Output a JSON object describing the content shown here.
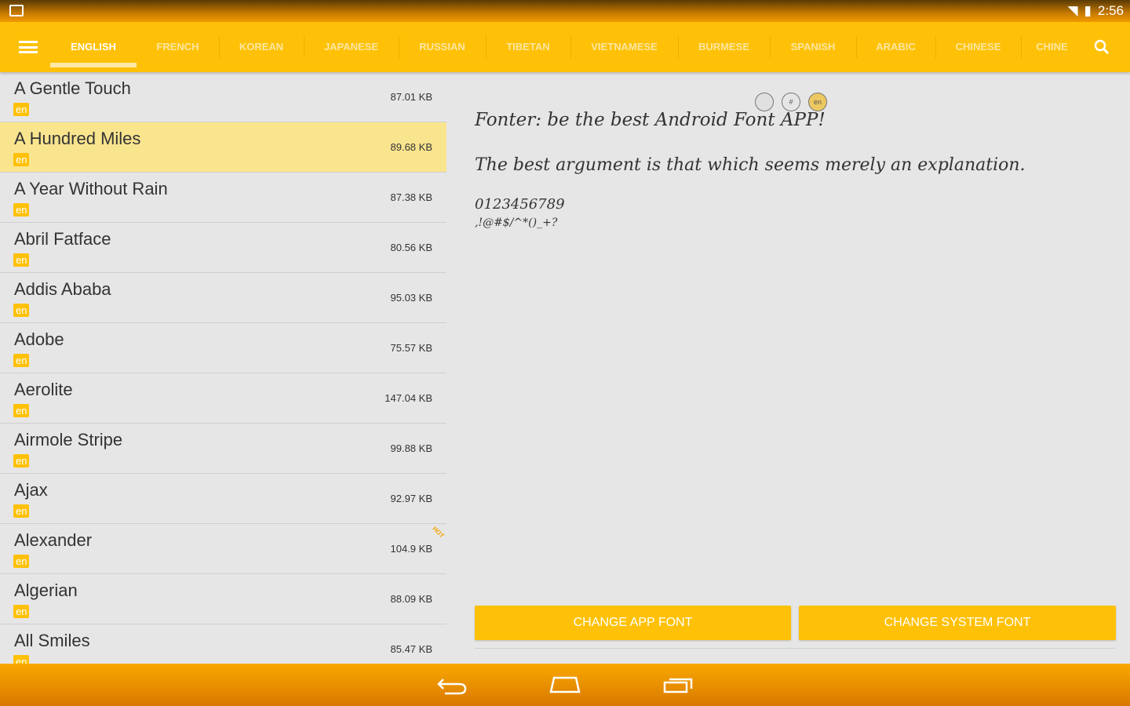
{
  "status_bar": {
    "time": "2:56",
    "icons": [
      "notification-app-icon",
      "wifi-icon",
      "signal-icon",
      "battery-charging-icon"
    ]
  },
  "toolbar": {
    "tabs": [
      "ENGLISH",
      "FRENCH",
      "KOREAN",
      "JAPANESE",
      "RUSSIAN",
      "TIBETAN",
      "VIETNAMESE",
      "BURMESE",
      "SPANISH",
      "ARABIC",
      "CHINESE",
      "CHINE"
    ],
    "active_tab": 0,
    "icons": [
      "menu-icon",
      "search-icon"
    ]
  },
  "fonts": [
    {
      "name": "A Gentle Touch",
      "lang": "en",
      "size": "87.01 KB"
    },
    {
      "name": "A Hundred Miles",
      "lang": "en",
      "size": "89.68 KB",
      "selected": true
    },
    {
      "name": "A Year Without Rain",
      "lang": "en",
      "size": "87.38 KB"
    },
    {
      "name": "Abril Fatface",
      "lang": "en",
      "size": "80.56 KB"
    },
    {
      "name": "Addis Ababa",
      "lang": "en",
      "size": "95.03 KB"
    },
    {
      "name": "Adobe",
      "lang": "en",
      "size": "75.57 KB"
    },
    {
      "name": "Aerolite",
      "lang": "en",
      "size": "147.04 KB"
    },
    {
      "name": "Airmole Stripe",
      "lang": "en",
      "size": "99.88 KB"
    },
    {
      "name": "Ajax",
      "lang": "en",
      "size": "92.97 KB"
    },
    {
      "name": "Alexander",
      "lang": "en",
      "size": "104.9 KB",
      "hot": "HOT"
    },
    {
      "name": "Algerian",
      "lang": "en",
      "size": "88.09 KB"
    },
    {
      "name": "All Smiles",
      "lang": "en",
      "size": "85.47 KB"
    }
  ],
  "preview": {
    "options": [
      "",
      "#",
      "en"
    ],
    "line1": "Fonter: be the best Android Font APP!",
    "line2": "The best argument is that which seems merely an explanation.",
    "digits": "0123456789",
    "symbols": ",!@#$/^*()_+?",
    "change_app_font": "CHANGE APP FONT",
    "change_system_font": "CHANGE SYSTEM FONT"
  },
  "colors": {
    "accent": "#FFC107",
    "selected_row": "#FAE58F",
    "background": "#E6E6E6"
  }
}
